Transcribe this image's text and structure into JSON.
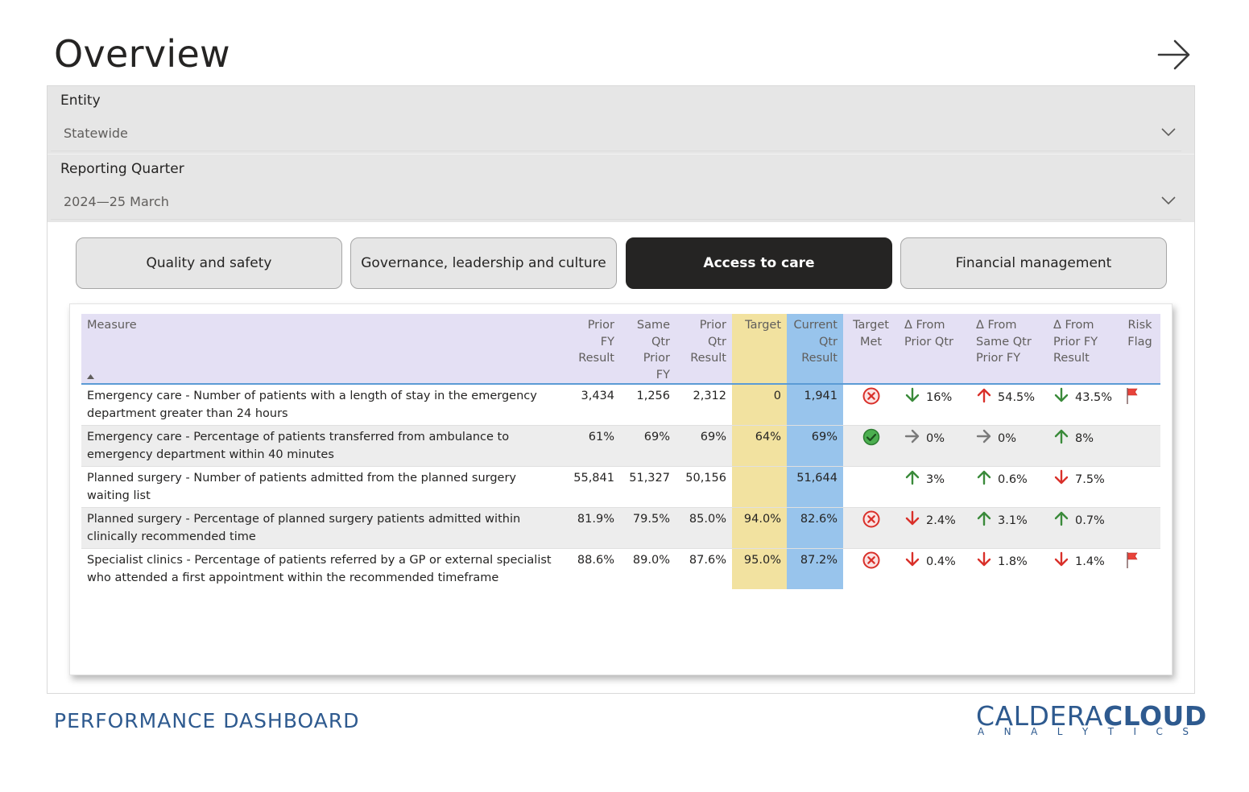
{
  "page": {
    "title": "Overview"
  },
  "filters": {
    "entity": {
      "label": "Entity",
      "value": "Statewide"
    },
    "quarter": {
      "label": "Reporting Quarter",
      "value": "2024—25 March"
    }
  },
  "tabs": [
    {
      "label": "Quality and safety",
      "active": false
    },
    {
      "label": "Governance, leadership and culture",
      "active": false
    },
    {
      "label": "Access to care",
      "active": true
    },
    {
      "label": "Financial management",
      "active": false
    }
  ],
  "table": {
    "columns": {
      "measure": "Measure",
      "prior_fy": "Prior FY Result",
      "same_qtr": "Same Qtr Prior FY",
      "prior_qtr": "Prior Qtr Result",
      "target": "Target",
      "current": "Current Qtr Result",
      "target_met": "Target Met",
      "d_prior_qtr": "Δ From Prior Qtr",
      "d_same_qtr": "Δ From Same Qtr Prior FY",
      "d_prior_fy": "Δ From Prior FY Result",
      "risk_flag": "Risk Flag"
    },
    "rows": [
      {
        "measure": "Emergency care - Number of patients with a length of stay in the emergency department greater than 24 hours",
        "prior_fy": "3,434",
        "same_qtr": "1,256",
        "prior_qtr": "2,312",
        "target": "0",
        "current": "1,941",
        "target_met": "no",
        "d_prior_qtr": {
          "dir": "down",
          "color": "green",
          "value": "16%"
        },
        "d_same_qtr": {
          "dir": "up",
          "color": "red",
          "value": "54.5%"
        },
        "d_prior_fy": {
          "dir": "down",
          "color": "green",
          "value": "43.5%"
        },
        "risk_flag": true
      },
      {
        "measure": "Emergency care - Percentage of patients transferred from ambulance to emergency department within 40 minutes",
        "prior_fy": "61%",
        "same_qtr": "69%",
        "prior_qtr": "69%",
        "target": "64%",
        "current": "69%",
        "target_met": "yes",
        "d_prior_qtr": {
          "dir": "flat",
          "color": "grey",
          "value": "0%"
        },
        "d_same_qtr": {
          "dir": "flat",
          "color": "grey",
          "value": "0%"
        },
        "d_prior_fy": {
          "dir": "up",
          "color": "green",
          "value": "8%"
        },
        "risk_flag": false
      },
      {
        "measure": "Planned surgery - Number of patients admitted from the planned surgery waiting list",
        "prior_fy": "55,841",
        "same_qtr": "51,327",
        "prior_qtr": "50,156",
        "target": "",
        "current": "51,644",
        "target_met": "none",
        "d_prior_qtr": {
          "dir": "up",
          "color": "green",
          "value": "3%"
        },
        "d_same_qtr": {
          "dir": "up",
          "color": "green",
          "value": "0.6%"
        },
        "d_prior_fy": {
          "dir": "down",
          "color": "red",
          "value": "7.5%"
        },
        "risk_flag": false
      },
      {
        "measure": "Planned surgery - Percentage of planned surgery patients admitted within clinically recommended time",
        "prior_fy": "81.9%",
        "same_qtr": "79.5%",
        "prior_qtr": "85.0%",
        "target": "94.0%",
        "current": "82.6%",
        "target_met": "no",
        "d_prior_qtr": {
          "dir": "down",
          "color": "red",
          "value": "2.4%"
        },
        "d_same_qtr": {
          "dir": "up",
          "color": "green",
          "value": "3.1%"
        },
        "d_prior_fy": {
          "dir": "up",
          "color": "green",
          "value": "0.7%"
        },
        "risk_flag": false
      },
      {
        "measure": "Specialist clinics - Percentage of patients referred by a GP or external specialist who attended a first appointment within the recommended timeframe",
        "prior_fy": "88.6%",
        "same_qtr": "89.0%",
        "prior_qtr": "87.6%",
        "target": "95.0%",
        "current": "87.2%",
        "target_met": "no",
        "d_prior_qtr": {
          "dir": "down",
          "color": "red",
          "value": "0.4%"
        },
        "d_same_qtr": {
          "dir": "down",
          "color": "red",
          "value": "1.8%"
        },
        "d_prior_fy": {
          "dir": "down",
          "color": "red",
          "value": "1.4%"
        },
        "risk_flag": true
      }
    ]
  },
  "colors": {
    "header_bg": "#e4e0f4",
    "target_bg": "#f2e2a0",
    "current_bg": "#98c4ec",
    "active_tab": "#252423",
    "up_green": "#3a8a3a",
    "down_red": "#d9302a",
    "flat_grey": "#7a7a7a",
    "brand_blue": "#2e5a8f"
  },
  "footer": {
    "title": "PERFORMANCE DASHBOARD",
    "logo_left": "CALDERA",
    "logo_right": "CLOUD",
    "logo_sub": [
      "A",
      "N",
      "A",
      "L",
      "Y",
      "T",
      "I",
      "C",
      "S"
    ]
  }
}
